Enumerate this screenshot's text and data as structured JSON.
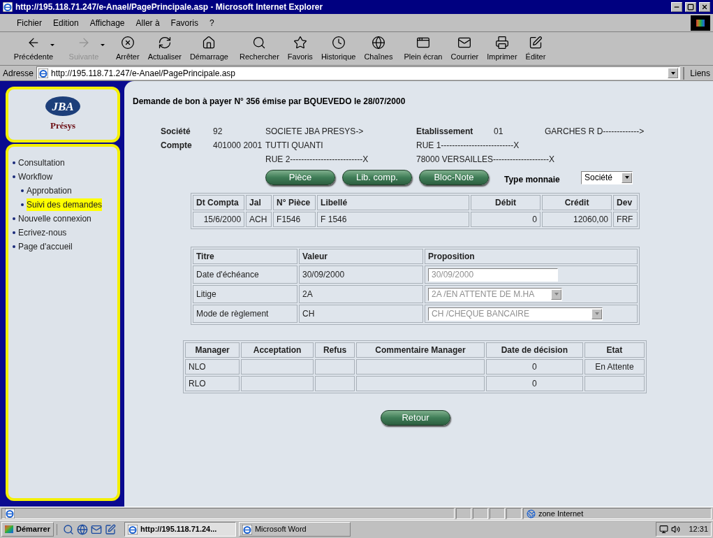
{
  "window": {
    "title": "http://195.118.71.247/e-Anael/PagePrincipale.asp - Microsoft Internet Explorer"
  },
  "menu_bar": [
    "Fichier",
    "Edition",
    "Affichage",
    "Aller à",
    "Favoris",
    "?"
  ],
  "toolbar": [
    {
      "label": "Précédente",
      "disabled": false,
      "has_menu": true
    },
    {
      "label": "Suivante",
      "disabled": true,
      "has_menu": true
    },
    {
      "label": "Arrêter",
      "disabled": false,
      "has_menu": false
    },
    {
      "label": "Actualiser",
      "disabled": false,
      "has_menu": false
    },
    {
      "label": "Démarrage",
      "disabled": false,
      "has_menu": false
    },
    {
      "label": "Rechercher",
      "disabled": false,
      "has_menu": false
    },
    {
      "label": "Favoris",
      "disabled": false,
      "has_menu": false
    },
    {
      "label": "Historique",
      "disabled": false,
      "has_menu": false
    },
    {
      "label": "Chaînes",
      "disabled": false,
      "has_menu": false
    },
    {
      "label": "Plein écran",
      "disabled": false,
      "has_menu": false
    },
    {
      "label": "Courrier",
      "disabled": false,
      "has_menu": false
    },
    {
      "label": "Imprimer",
      "disabled": false,
      "has_menu": false
    },
    {
      "label": "Éditer",
      "disabled": false,
      "has_menu": false
    }
  ],
  "address_bar": {
    "label": "Adresse",
    "url": "http://195.118.71.247/e-Anael/PagePrincipale.asp",
    "links": "Liens"
  },
  "sidebar": {
    "logo_text": "JBA",
    "brand": "Présys",
    "nav": [
      {
        "label": "Consultation",
        "selected": false
      },
      {
        "label": "Workflow",
        "selected": false,
        "children": [
          {
            "label": "Approbation",
            "selected": false
          },
          {
            "label": "Suivi des demandes",
            "selected": true
          }
        ]
      },
      {
        "label": "Nouvelle connexion",
        "selected": false
      },
      {
        "label": "Ecrivez-nous",
        "selected": false
      },
      {
        "label": "Page d'accueil",
        "selected": false
      }
    ]
  },
  "page": {
    "title": "Demande de bon à payer N° 356 émise par BQUEVEDO le 28/07/2000",
    "company": {
      "label": "Société",
      "code": "92",
      "name": "SOCIETE JBA PRESYS->"
    },
    "establishment": {
      "label": "Etablissement",
      "code": "01",
      "name": "GARCHES R D------------->",
      "address_lines": [
        "RUE 1--------------------------X",
        "78000 VERSAILLES--------------------X"
      ]
    },
    "account": {
      "label": "Compte",
      "code": "401000 2001",
      "name": "TUTTI QUANTI",
      "address": "RUE 2--------------------------X"
    },
    "buttons": [
      "Pièce",
      "Lib. comp.",
      "Bloc-Note"
    ],
    "currency": {
      "label": "Type monnaie",
      "value": "Société"
    },
    "entries": {
      "columns": [
        "Dt Compta",
        "Jal",
        "N° Pièce",
        "Libellé",
        "Débit",
        "Crédit",
        "Dev"
      ],
      "rows": [
        [
          "15/6/2000",
          "ACH",
          "F1546",
          "F 1546",
          "0",
          "12060,00",
          "FRF"
        ]
      ]
    },
    "proposal": {
      "columns": [
        "Titre",
        "Valeur",
        "Proposition"
      ],
      "rows": [
        {
          "title": "Date d'échéance",
          "value": "30/09/2000",
          "proposal": "30/09/2000",
          "kind": "text",
          "disabled": true
        },
        {
          "title": "Litige",
          "value": "2A",
          "proposal": "2A /EN ATTENTE DE M.HA",
          "kind": "select",
          "disabled": true
        },
        {
          "title": "Mode de règlement",
          "value": "CH",
          "proposal": "CH /CHEQUE BANCAIRE",
          "kind": "select",
          "disabled": true
        }
      ]
    },
    "managers": {
      "columns": [
        "Manager",
        "Acceptation",
        "Refus",
        "Commentaire Manager",
        "Date de décision",
        "Etat"
      ],
      "rows": [
        {
          "manager": "NLO",
          "decision_date": "0",
          "status": "En Attente"
        },
        {
          "manager": "RLO",
          "decision_date": "0"
        }
      ]
    },
    "return_button": "Retour"
  },
  "status_bar": {
    "zone": "zone Internet"
  },
  "taskbar": {
    "start": "Démarrer",
    "tasks": [
      {
        "label": "http://195.118.71.24...",
        "selected": true
      },
      {
        "label": "Microsoft Word",
        "selected": false
      }
    ],
    "clock": "12:31"
  }
}
